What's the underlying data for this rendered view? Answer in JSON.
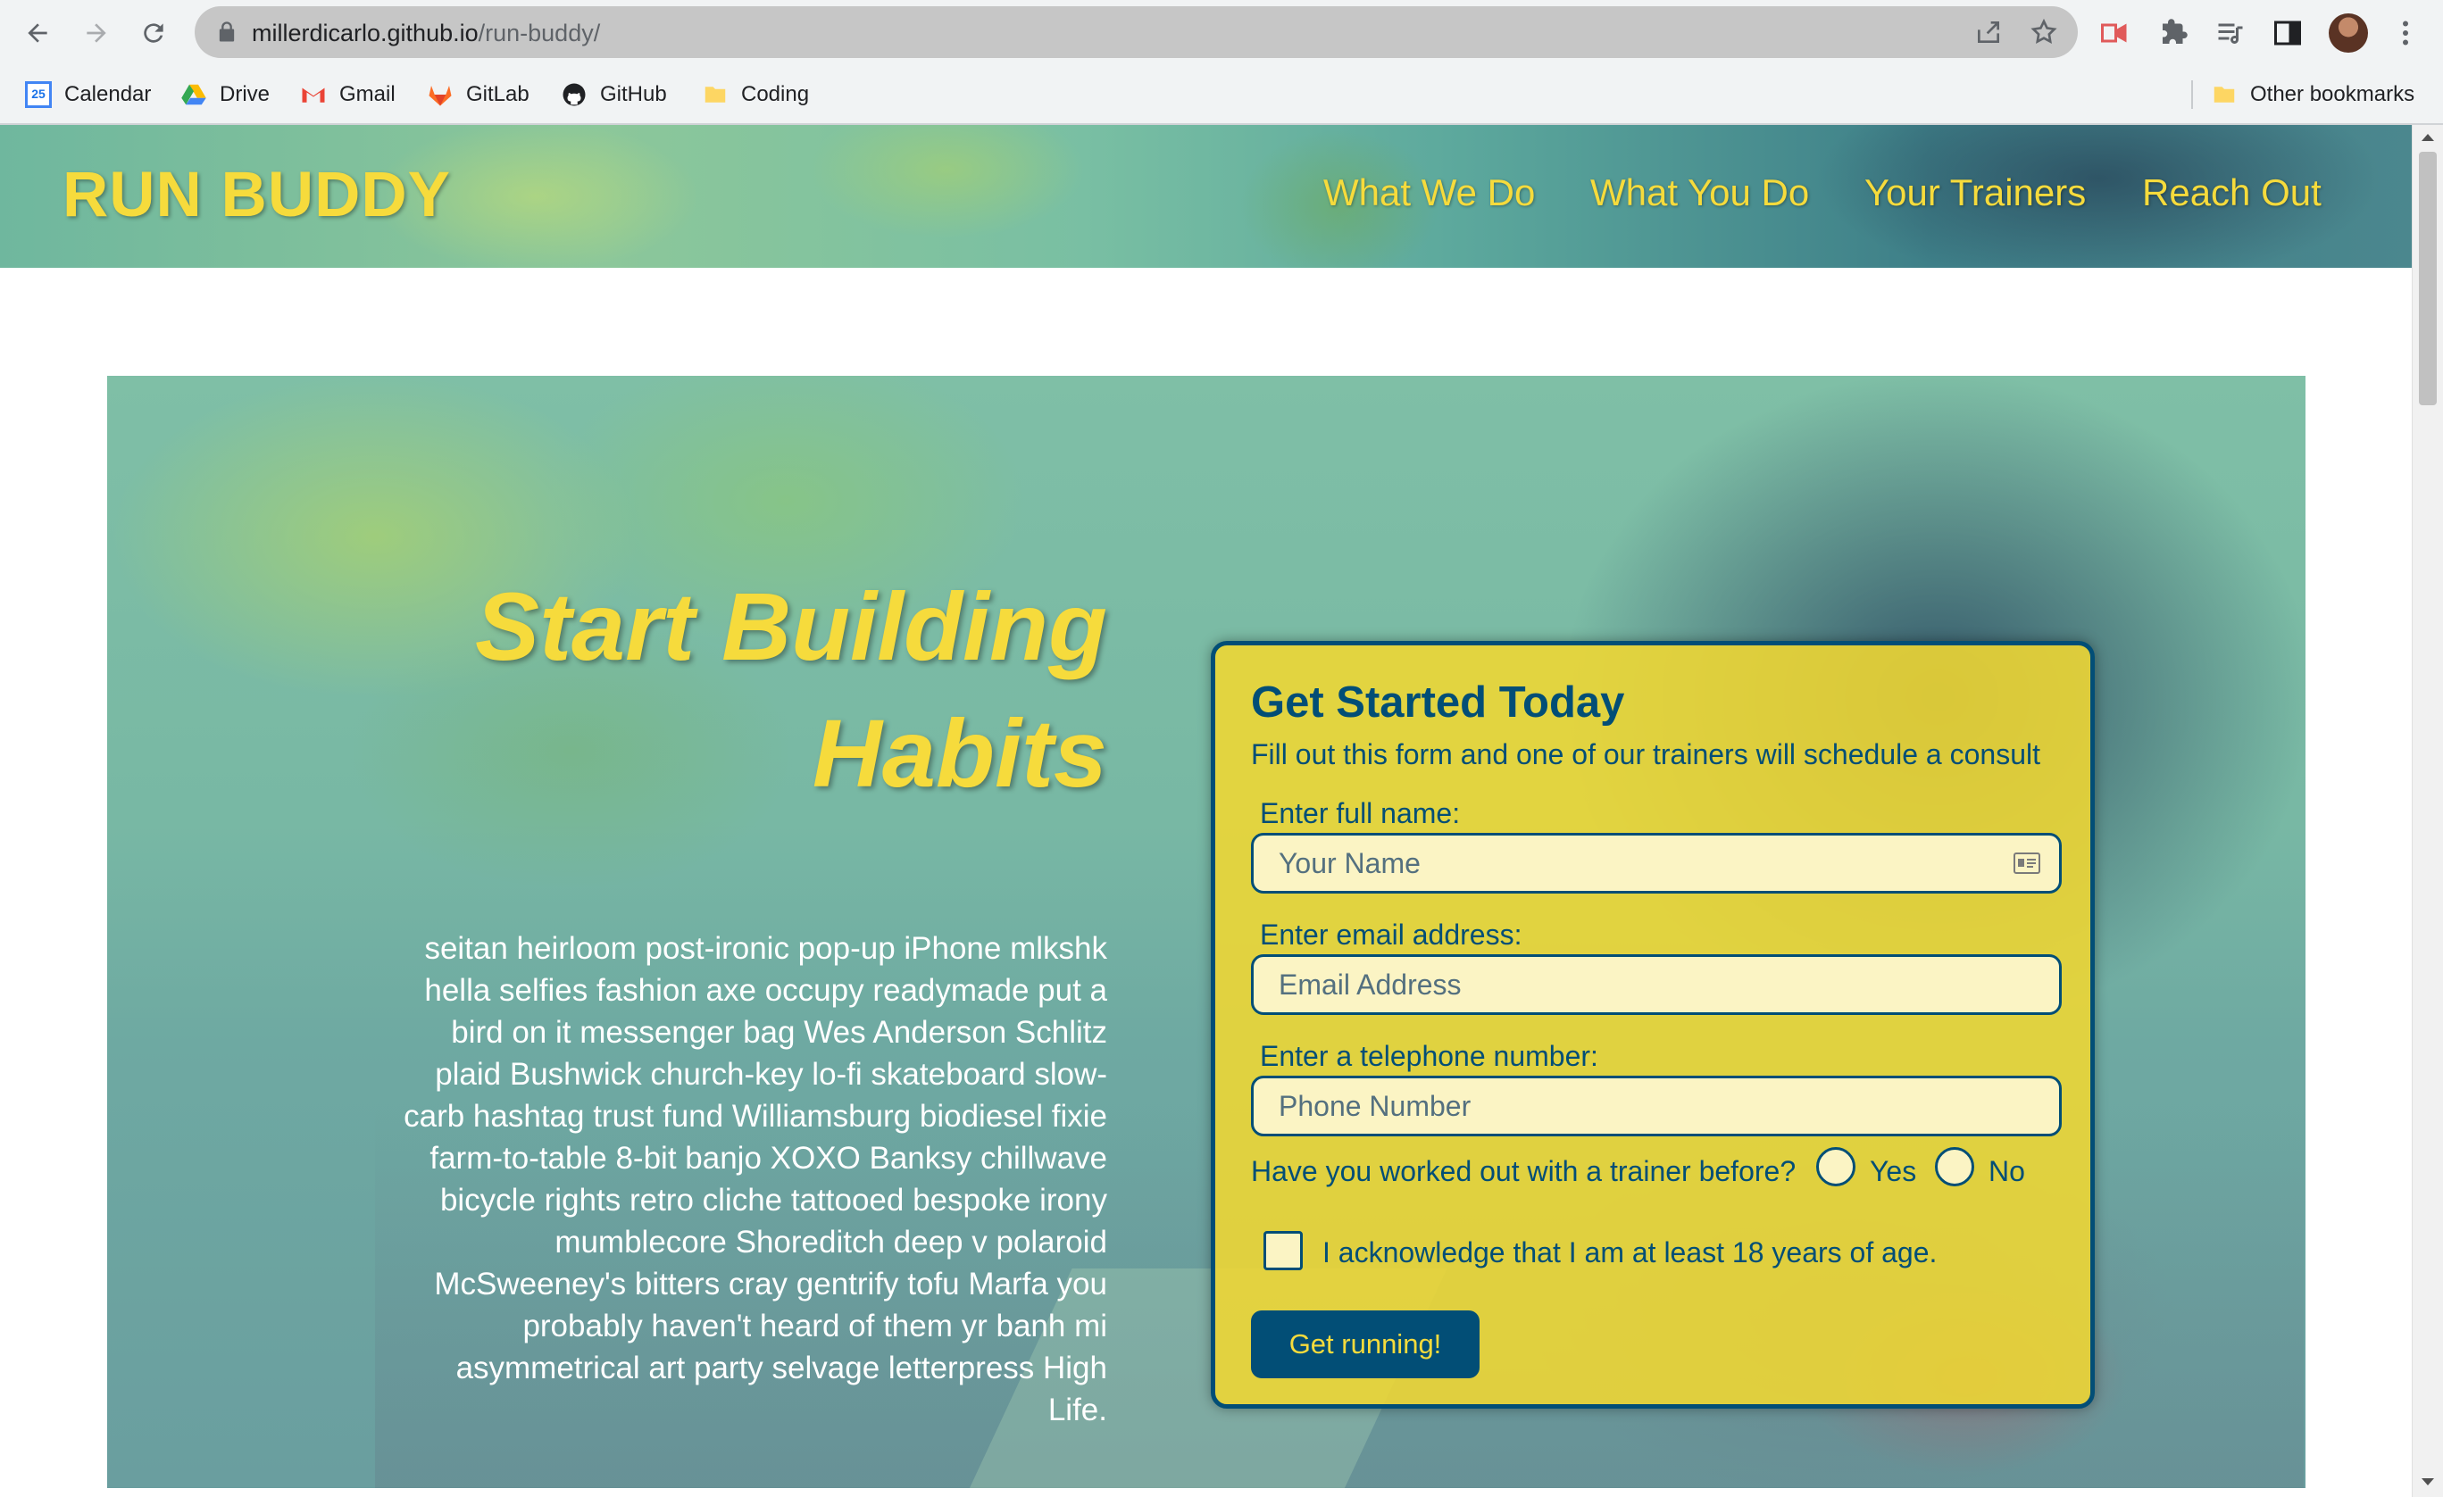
{
  "browser": {
    "url_host": "millerdicarlo.github.io",
    "url_path": "/run-buddy/",
    "bookmarks": [
      "Calendar",
      "Drive",
      "Gmail",
      "GitLab",
      "GitHub",
      "Coding"
    ],
    "other_bookmarks": "Other bookmarks",
    "calendar_day": "25"
  },
  "header": {
    "logo": "RUN BUDDY",
    "nav": [
      "What We Do",
      "What You Do",
      "Your Trainers",
      "Reach Out"
    ]
  },
  "hero": {
    "title_line1": "Start Building",
    "title_line2": "Habits",
    "body": "seitan heirloom post-ironic pop-up iPhone mlkshk hella selfies fashion axe occupy readymade put a bird on it messenger bag Wes Anderson Schlitz plaid Bushwick church-key lo-fi skateboard slow-carb hashtag trust fund Williamsburg biodiesel fixie farm-to-table 8-bit banjo XOXO Banksy chillwave bicycle rights retro cliche tattooed bespoke irony mumblecore Shoreditch deep v polaroid McSweeney's bitters cray gentrify tofu Marfa you probably haven't heard of them yr banh mi asymmetrical art party selvage letterpress High Life."
  },
  "form": {
    "title": "Get Started Today",
    "subtitle": "Fill out this form and one of our trainers will schedule a consult",
    "name_label": "Enter full name:",
    "name_placeholder": "Your Name",
    "email_label": "Enter email address:",
    "email_placeholder": "Email Address",
    "phone_label": "Enter a telephone number:",
    "phone_placeholder": "Phone Number",
    "trainer_question": "Have you worked out with a trainer before?",
    "yes_label": "Yes",
    "no_label": "No",
    "age_ack": "I acknowledge that I am at least 18 years of age.",
    "submit_label": "Get running!"
  },
  "colors": {
    "brand_yellow": "#f6db3c",
    "brand_navy": "#024e76"
  }
}
